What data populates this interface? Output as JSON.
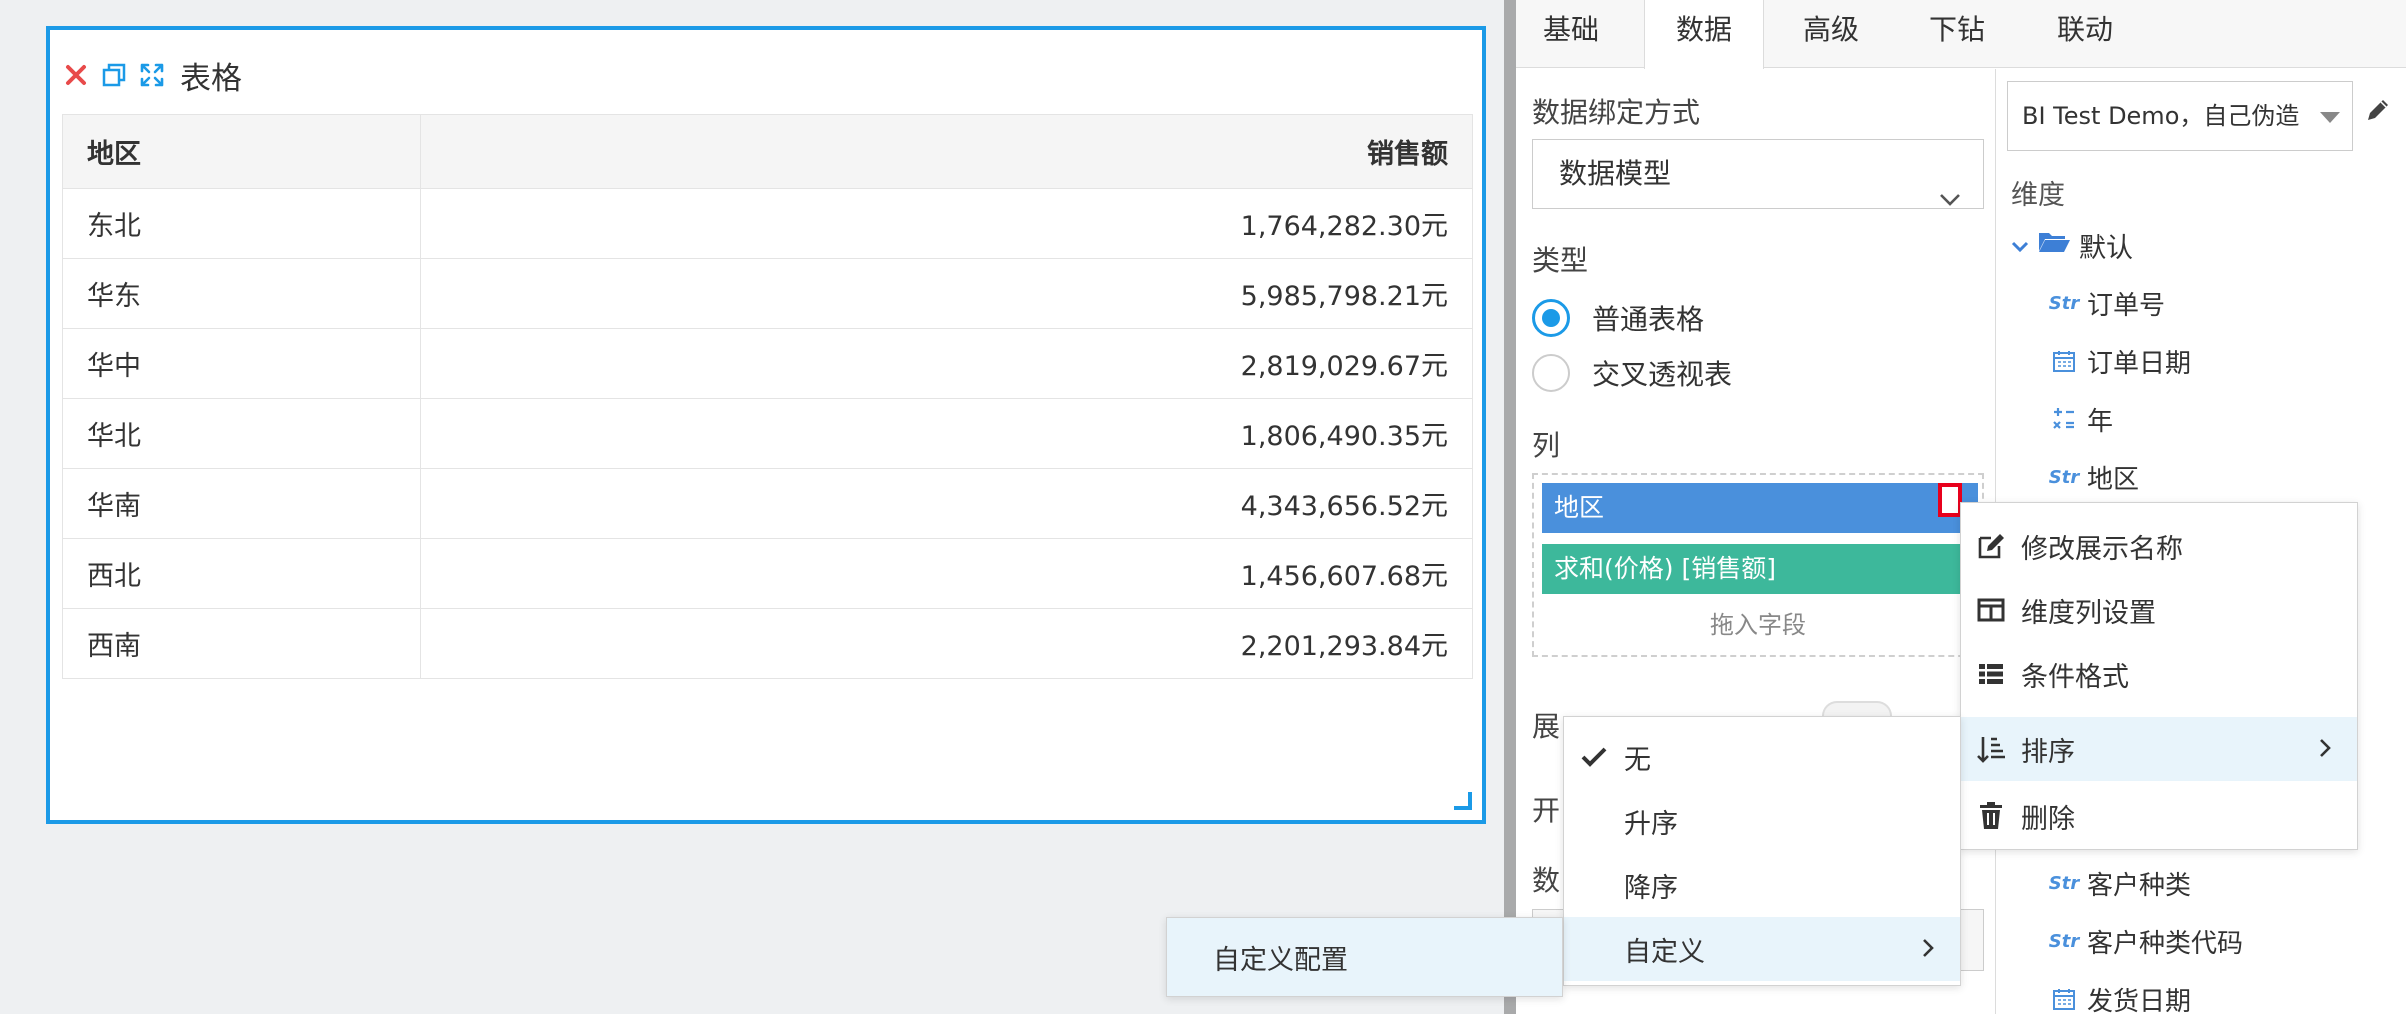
{
  "widget": {
    "title": "表格",
    "columns": [
      "地区",
      "销售额"
    ],
    "rows": [
      [
        "东北",
        "1,764,282.30元"
      ],
      [
        "华东",
        "5,985,798.21元"
      ],
      [
        "华中",
        "2,819,029.67元"
      ],
      [
        "华北",
        "1,806,490.35元"
      ],
      [
        "华南",
        "4,343,656.52元"
      ],
      [
        "西北",
        "1,456,607.68元"
      ],
      [
        "西南",
        "2,201,293.84元"
      ]
    ]
  },
  "panel": {
    "tabs": [
      "基础",
      "数据",
      "高级",
      "下钻",
      "联动"
    ],
    "active_tab": "数据",
    "binding_label": "数据绑定方式",
    "binding_value": "数据模型",
    "type_label": "类型",
    "type_options": [
      "普通表格",
      "交叉透视表"
    ],
    "columns_label": "列",
    "column_chips": [
      "地区",
      "求和(价格) [销售额]"
    ],
    "drop_hint": "拖入字段",
    "partial_labels": [
      "展",
      "开",
      "数"
    ]
  },
  "fields": {
    "dataset": "BI Test Demo，自己伪造",
    "dimension_label": "维度",
    "folder": "默认",
    "top_items": [
      {
        "type": "Str",
        "name": "订单号"
      },
      {
        "type": "date",
        "name": "订单日期"
      },
      {
        "type": "num",
        "name": "年"
      },
      {
        "type": "Str",
        "name": "地区"
      }
    ],
    "bottom_items": [
      {
        "type": "Str",
        "name": "客户种类"
      },
      {
        "type": "Str",
        "name": "客户种类代码"
      },
      {
        "type": "date",
        "name": "发货日期"
      }
    ]
  },
  "menus": {
    "main": [
      "修改展示名称",
      "维度列设置",
      "条件格式",
      "排序",
      "删除"
    ],
    "sort": [
      "无",
      "升序",
      "降序",
      "自定义"
    ],
    "custom": [
      "自定义配置"
    ]
  },
  "colors": {
    "accent": "#1b9ae7",
    "dimension_chip": "#4a90dc",
    "measure_chip": "#3db89b",
    "delete_red": "#e8001c",
    "menu_highlight": "#e8f4fb"
  }
}
